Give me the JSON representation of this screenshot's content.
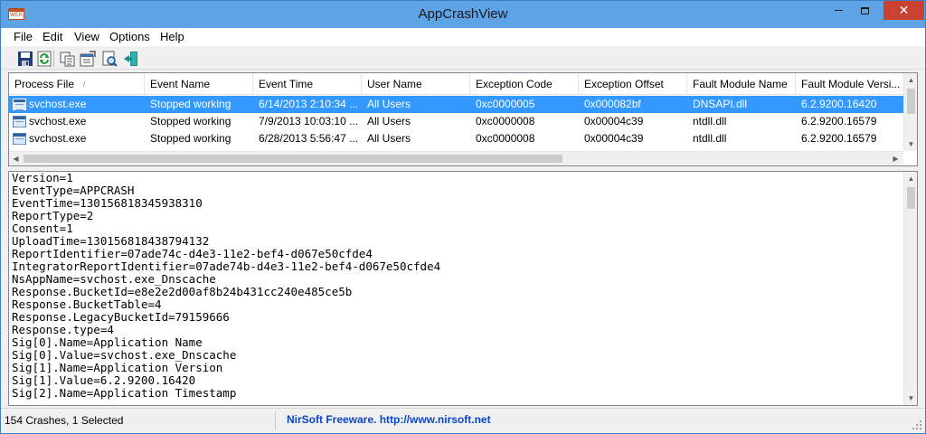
{
  "window": {
    "title": "AppCrashView",
    "app_icon_text": "WER",
    "controls": {
      "minimize": "minimize",
      "maximize": "maximize",
      "close": "✕"
    }
  },
  "menu": [
    "File",
    "Edit",
    "View",
    "Options",
    "Help"
  ],
  "toolbar": {
    "buttons": [
      "save-icon",
      "refresh-icon",
      "copy-icon",
      "properties-icon",
      "find-icon",
      "exit-icon"
    ]
  },
  "list": {
    "columns": [
      "Process File",
      "Event Name",
      "Event Time",
      "User Name",
      "Exception Code",
      "Exception Offset",
      "Fault Module Name",
      "Fault Module Versi..."
    ],
    "rows": [
      [
        "svchost.exe",
        "Stopped working",
        "6/14/2013 2:10:34 ...",
        "All Users",
        "0xc0000005",
        "0x000082bf",
        "DNSAPI.dll",
        "6.2.9200.16420"
      ],
      [
        "svchost.exe",
        "Stopped working",
        "7/9/2013 10:03:10 ...",
        "All Users",
        "0xc0000008",
        "0x00004c39",
        "ntdll.dll",
        "6.2.9200.16579"
      ],
      [
        "svchost.exe",
        "Stopped working",
        "6/28/2013 5:56:47 ...",
        "All Users",
        "0xc0000008",
        "0x00004c39",
        "ntdll.dll",
        "6.2.9200.16579"
      ]
    ],
    "selected_row_index": 0
  },
  "details": {
    "lines": [
      "Version=1",
      "EventType=APPCRASH",
      "EventTime=130156818345938310",
      "ReportType=2",
      "Consent=1",
      "UploadTime=130156818438794132",
      "ReportIdentifier=07ade74c-d4e3-11e2-bef4-d067e50cfde4",
      "IntegratorReportIdentifier=07ade74b-d4e3-11e2-bef4-d067e50cfde4",
      "NsAppName=svchost.exe_Dnscache",
      "Response.BucketId=e8e2e2d00af8b24b431cc240e485ce5b",
      "Response.BucketTable=4",
      "Response.LegacyBucketId=79159666",
      "Response.type=4",
      "Sig[0].Name=Application Name",
      "Sig[0].Value=svchost.exe_Dnscache",
      "Sig[1].Name=Application Version",
      "Sig[1].Value=6.2.9200.16420",
      "Sig[2].Name=Application Timestamp"
    ]
  },
  "status": {
    "summary": "154 Crashes, 1 Selected",
    "link_text": "NirSoft Freeware.  http://www.nirsoft.net"
  },
  "colors": {
    "titlebar": "#5da3e6",
    "selection": "#3399ff",
    "close_button": "#c84131",
    "link": "#0b47c9"
  }
}
